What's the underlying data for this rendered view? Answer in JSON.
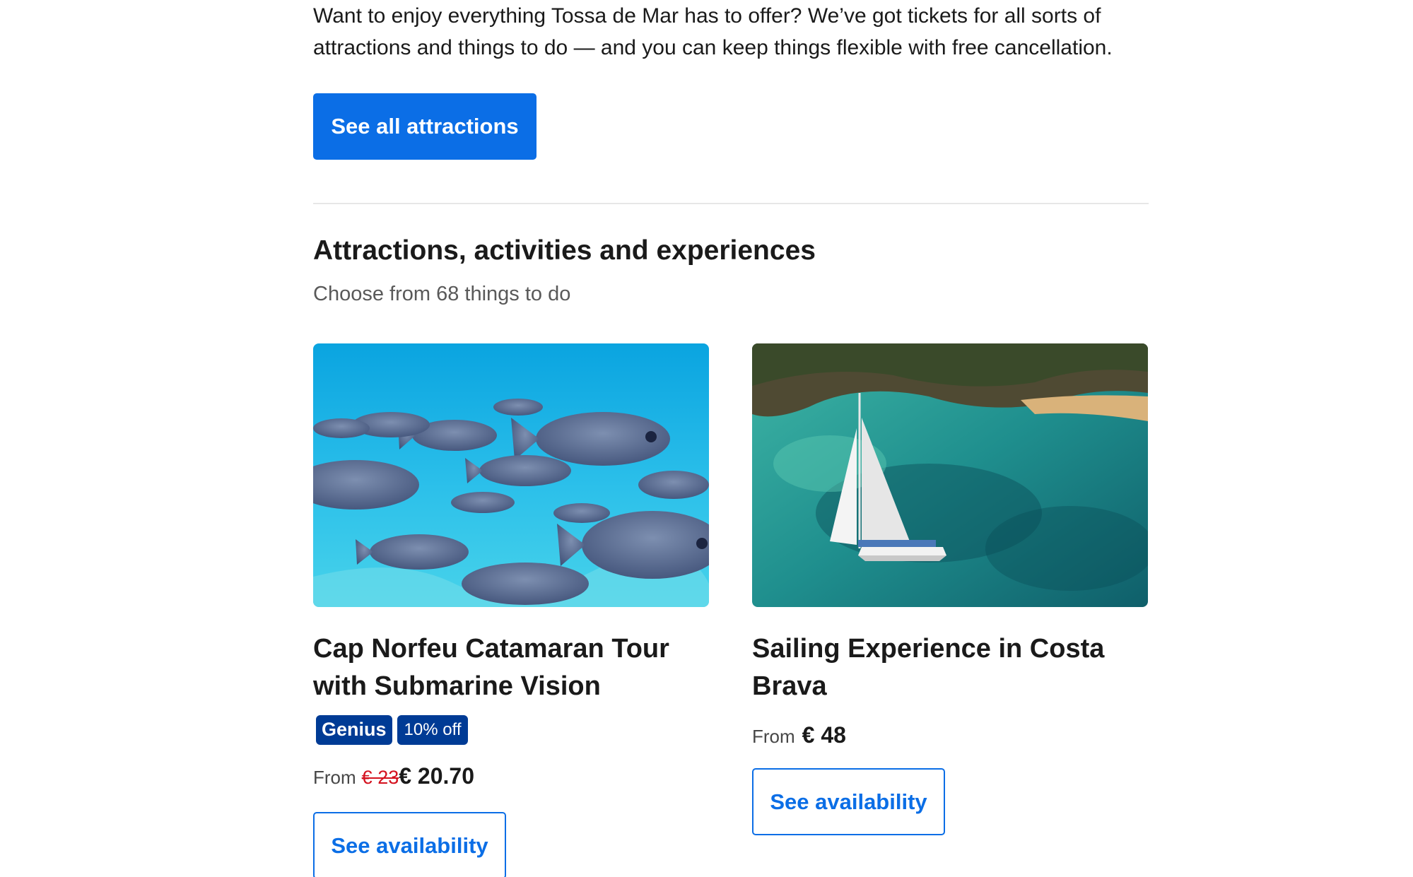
{
  "intro": {
    "text": "Want to enjoy everything Tossa de Mar has to offer? We’ve got tickets for all sorts of attractions and things to do — and you can keep things flexible with free cancellation."
  },
  "see_all_button": "See all attractions",
  "section": {
    "title": "Attractions, activities and experiences",
    "subtitle": "Choose from 68 things to do"
  },
  "cards": [
    {
      "title": "Cap Norfeu Catamaran Tour with Submarine Vision",
      "badge_genius": "Genius",
      "badge_discount": "10% off",
      "price_from": "From",
      "price_old": "€ 23",
      "price_now": "€ 20.70",
      "cta": "See availability",
      "image": "underwater-fish-photo"
    },
    {
      "title": "Sailing Experience in Costa Brava",
      "price_from": "From",
      "price_now": "€ 48",
      "cta": "See availability",
      "image": "catamaran-bay-photo"
    }
  ],
  "colors": {
    "primary": "#0b6ee6",
    "genius": "#003b95",
    "strike": "#d4111e"
  }
}
